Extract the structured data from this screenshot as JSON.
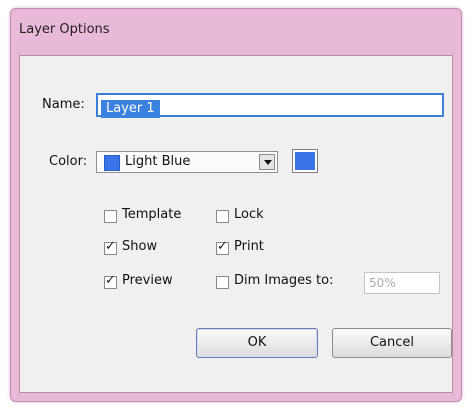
{
  "window": {
    "title": "Layer Options"
  },
  "name": {
    "label": "Name:",
    "value": "Layer 1"
  },
  "color": {
    "label": "Color:",
    "value": "Light Blue",
    "swatch": "#3b74e8"
  },
  "options": {
    "template": {
      "label": "Template",
      "checked": false
    },
    "lock": {
      "label": "Lock",
      "checked": false
    },
    "show": {
      "label": "Show",
      "checked": true
    },
    "print": {
      "label": "Print",
      "checked": true
    },
    "preview": {
      "label": "Preview",
      "checked": true
    },
    "dim_images": {
      "label": "Dim Images to:",
      "checked": false,
      "value": "50%"
    }
  },
  "buttons": {
    "ok": "OK",
    "cancel": "Cancel"
  }
}
